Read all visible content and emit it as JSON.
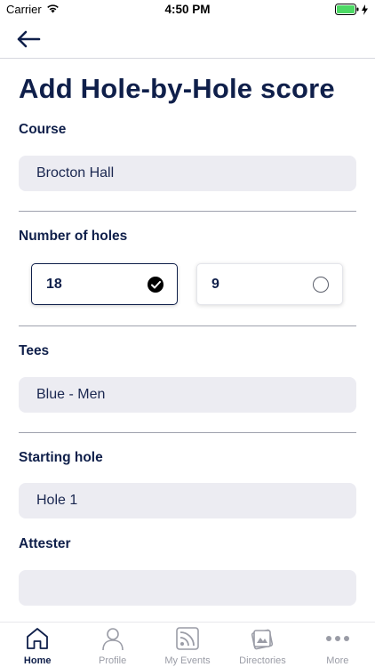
{
  "status_bar": {
    "carrier": "Carrier",
    "time": "4:50 PM"
  },
  "page": {
    "title": "Add Hole-by-Hole score"
  },
  "course": {
    "label": "Course",
    "value": "Brocton Hall"
  },
  "holes": {
    "label": "Number of holes",
    "options": [
      {
        "label": "18",
        "selected": true
      },
      {
        "label": "9",
        "selected": false
      }
    ]
  },
  "tees": {
    "label": "Tees",
    "value": "Blue - Men"
  },
  "starting_hole": {
    "label": "Starting hole",
    "value": "Hole 1"
  },
  "attester": {
    "label": "Attester",
    "value": ""
  },
  "tab_bar": {
    "items": [
      {
        "label": "Home",
        "icon": "home-icon",
        "active": true
      },
      {
        "label": "Profile",
        "icon": "person-icon",
        "active": false
      },
      {
        "label": "My Events",
        "icon": "feed-icon",
        "active": false
      },
      {
        "label": "Directories",
        "icon": "directory-icon",
        "active": false
      },
      {
        "label": "More",
        "icon": "more-dots-icon",
        "active": false
      }
    ]
  },
  "colors": {
    "primary": "#0f1f4a",
    "field_bg": "#ececf2",
    "battery": "#4cd964",
    "inactive_tab": "#9a9ca6"
  }
}
